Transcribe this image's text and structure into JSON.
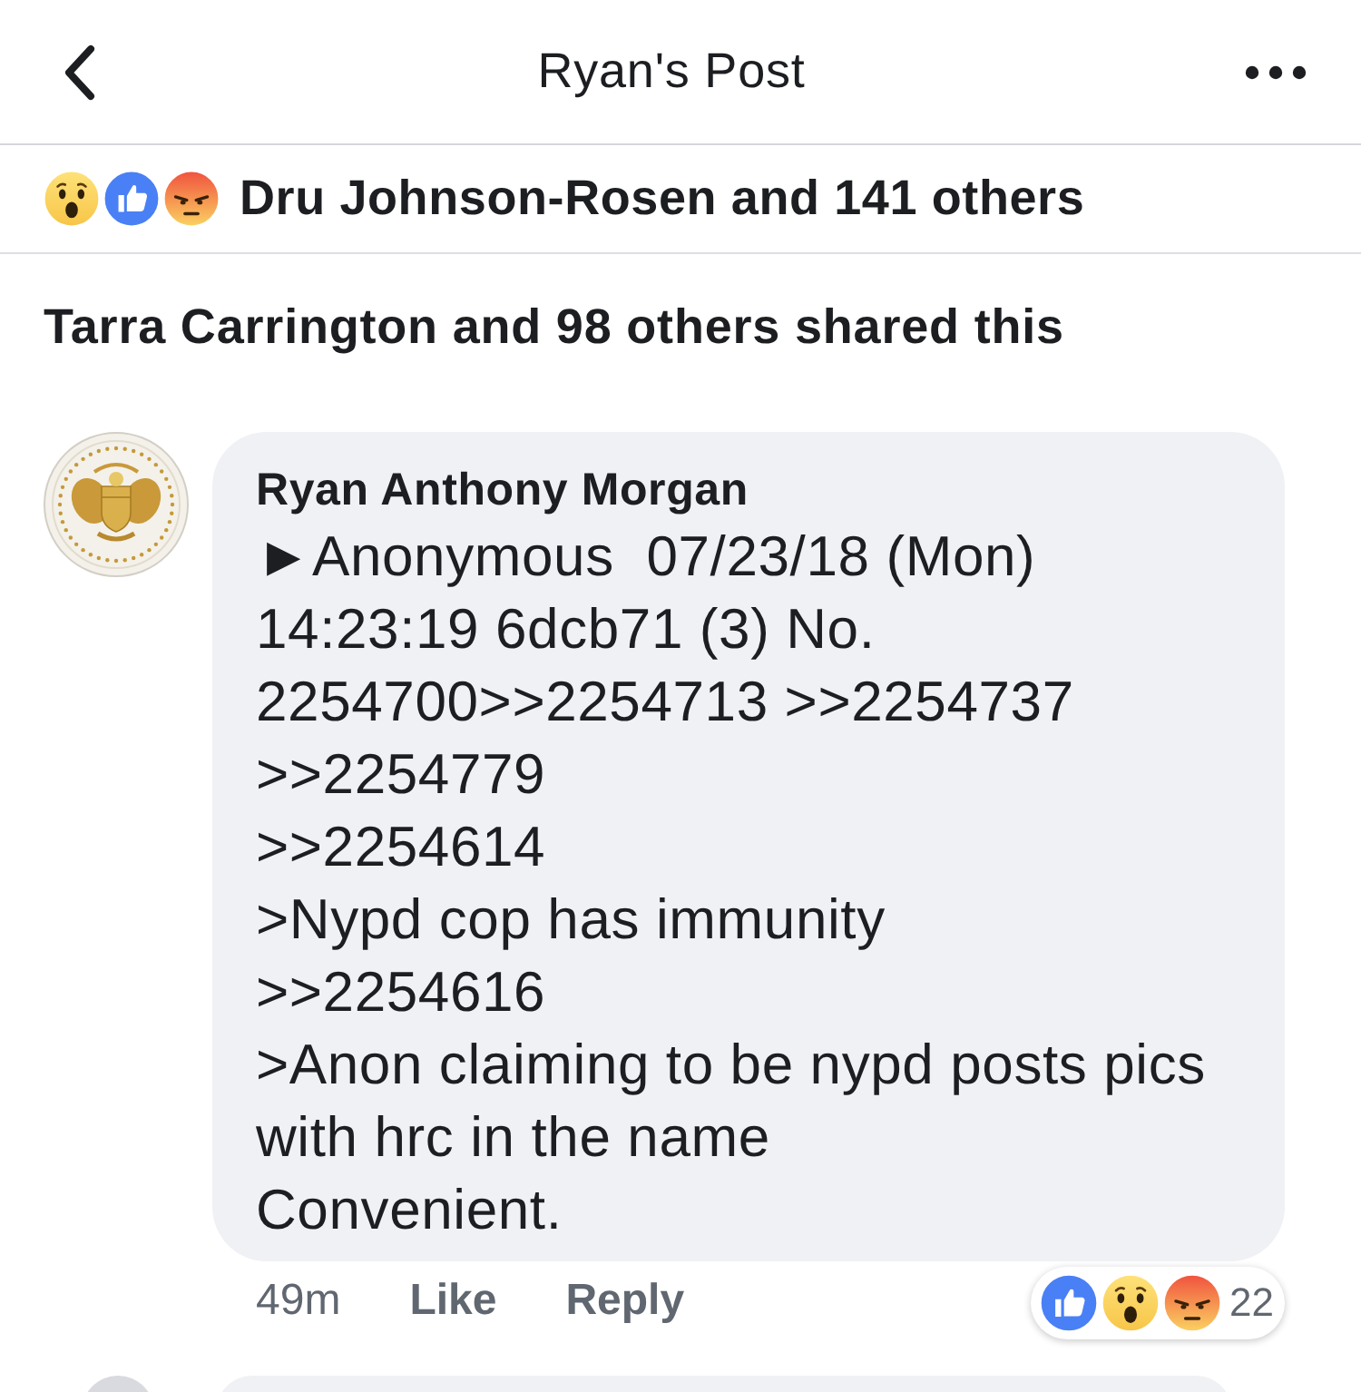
{
  "header": {
    "title": "Ryan's Post"
  },
  "reactions_summary": {
    "reactions": [
      {
        "kind": "wow"
      },
      {
        "kind": "like"
      },
      {
        "kind": "angry"
      }
    ],
    "text": "Dru Johnson-Rosen and 141 others"
  },
  "shares": {
    "text": "Tarra Carrington and 98 others shared this"
  },
  "comment": {
    "author": "Ryan Anthony Morgan",
    "lines": [
      "►Anonymous  07/23/18 (Mon)",
      "14:23:19 6dcb71 (3) No.",
      "2254700>>2254713 >>2254737",
      ">>2254779",
      ">>2254614",
      ">Nypd cop has immunity",
      ">>2254616",
      ">Anon claiming to be nypd posts pics",
      "with hrc in the name",
      "Convenient."
    ],
    "time": "49m",
    "actions": [
      "Like",
      "Reply"
    ],
    "reactions": [
      {
        "kind": "like"
      },
      {
        "kind": "wow"
      },
      {
        "kind": "angry"
      }
    ],
    "reaction_count": "22"
  }
}
